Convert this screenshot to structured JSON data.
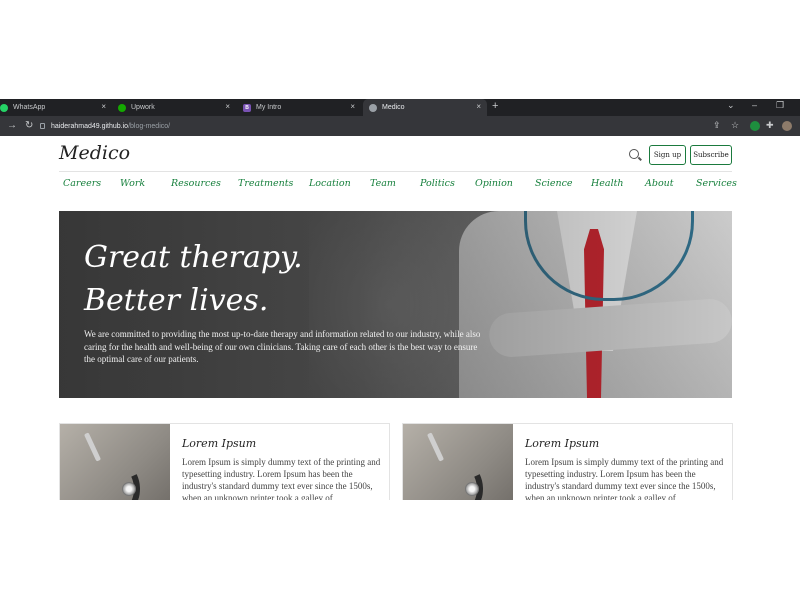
{
  "browser": {
    "tabs": [
      {
        "title": "WhatsApp",
        "fav_color": "#25d366"
      },
      {
        "title": "Upwork",
        "fav_color": "#14a800"
      },
      {
        "title": "My Intro",
        "fav_color": "#7952b3",
        "fav_letter": "B"
      },
      {
        "title": "Medico",
        "fav_color": "#9aa0a6"
      }
    ],
    "url_host": "haiderahmad49.github.io",
    "url_path": "/blog-medico/",
    "new_tab_label": "+",
    "tab_close_label": "×"
  },
  "header": {
    "brand": "Medico",
    "signup_label": "Sign up",
    "subscribe_label": "Subscribe"
  },
  "nav": [
    "Careers",
    "Work",
    "Resources",
    "Treatments",
    "Location",
    "Team",
    "Politics",
    "Opinion",
    "Science",
    "Health",
    "About",
    "Services"
  ],
  "hero": {
    "line1": "Great therapy.",
    "line2": "Better lives.",
    "text": "We are committed to providing the most up-to-date therapy and information related to our industry, while also caring for the health and well-being of our own clinicians. Taking care of each other is the best way to ensure the optimal care of our patients."
  },
  "cards": [
    {
      "title": "Lorem Ipsum",
      "text": "Lorem Ipsum is simply dummy text of the printing and typesetting industry. Lorem Ipsum has been the industry's standard dummy text ever since the 1500s, when an unknown printer took a galley of"
    },
    {
      "title": "Lorem Ipsum",
      "text": "Lorem Ipsum is simply dummy text of the printing and typesetting industry. Lorem Ipsum has been the industry's standard dummy text ever since the 1500s, when an unknown printer took a galley of"
    }
  ],
  "colors": {
    "accent": "#17803d",
    "chrome": "#202124",
    "chrome_toolbar": "#35363a"
  }
}
